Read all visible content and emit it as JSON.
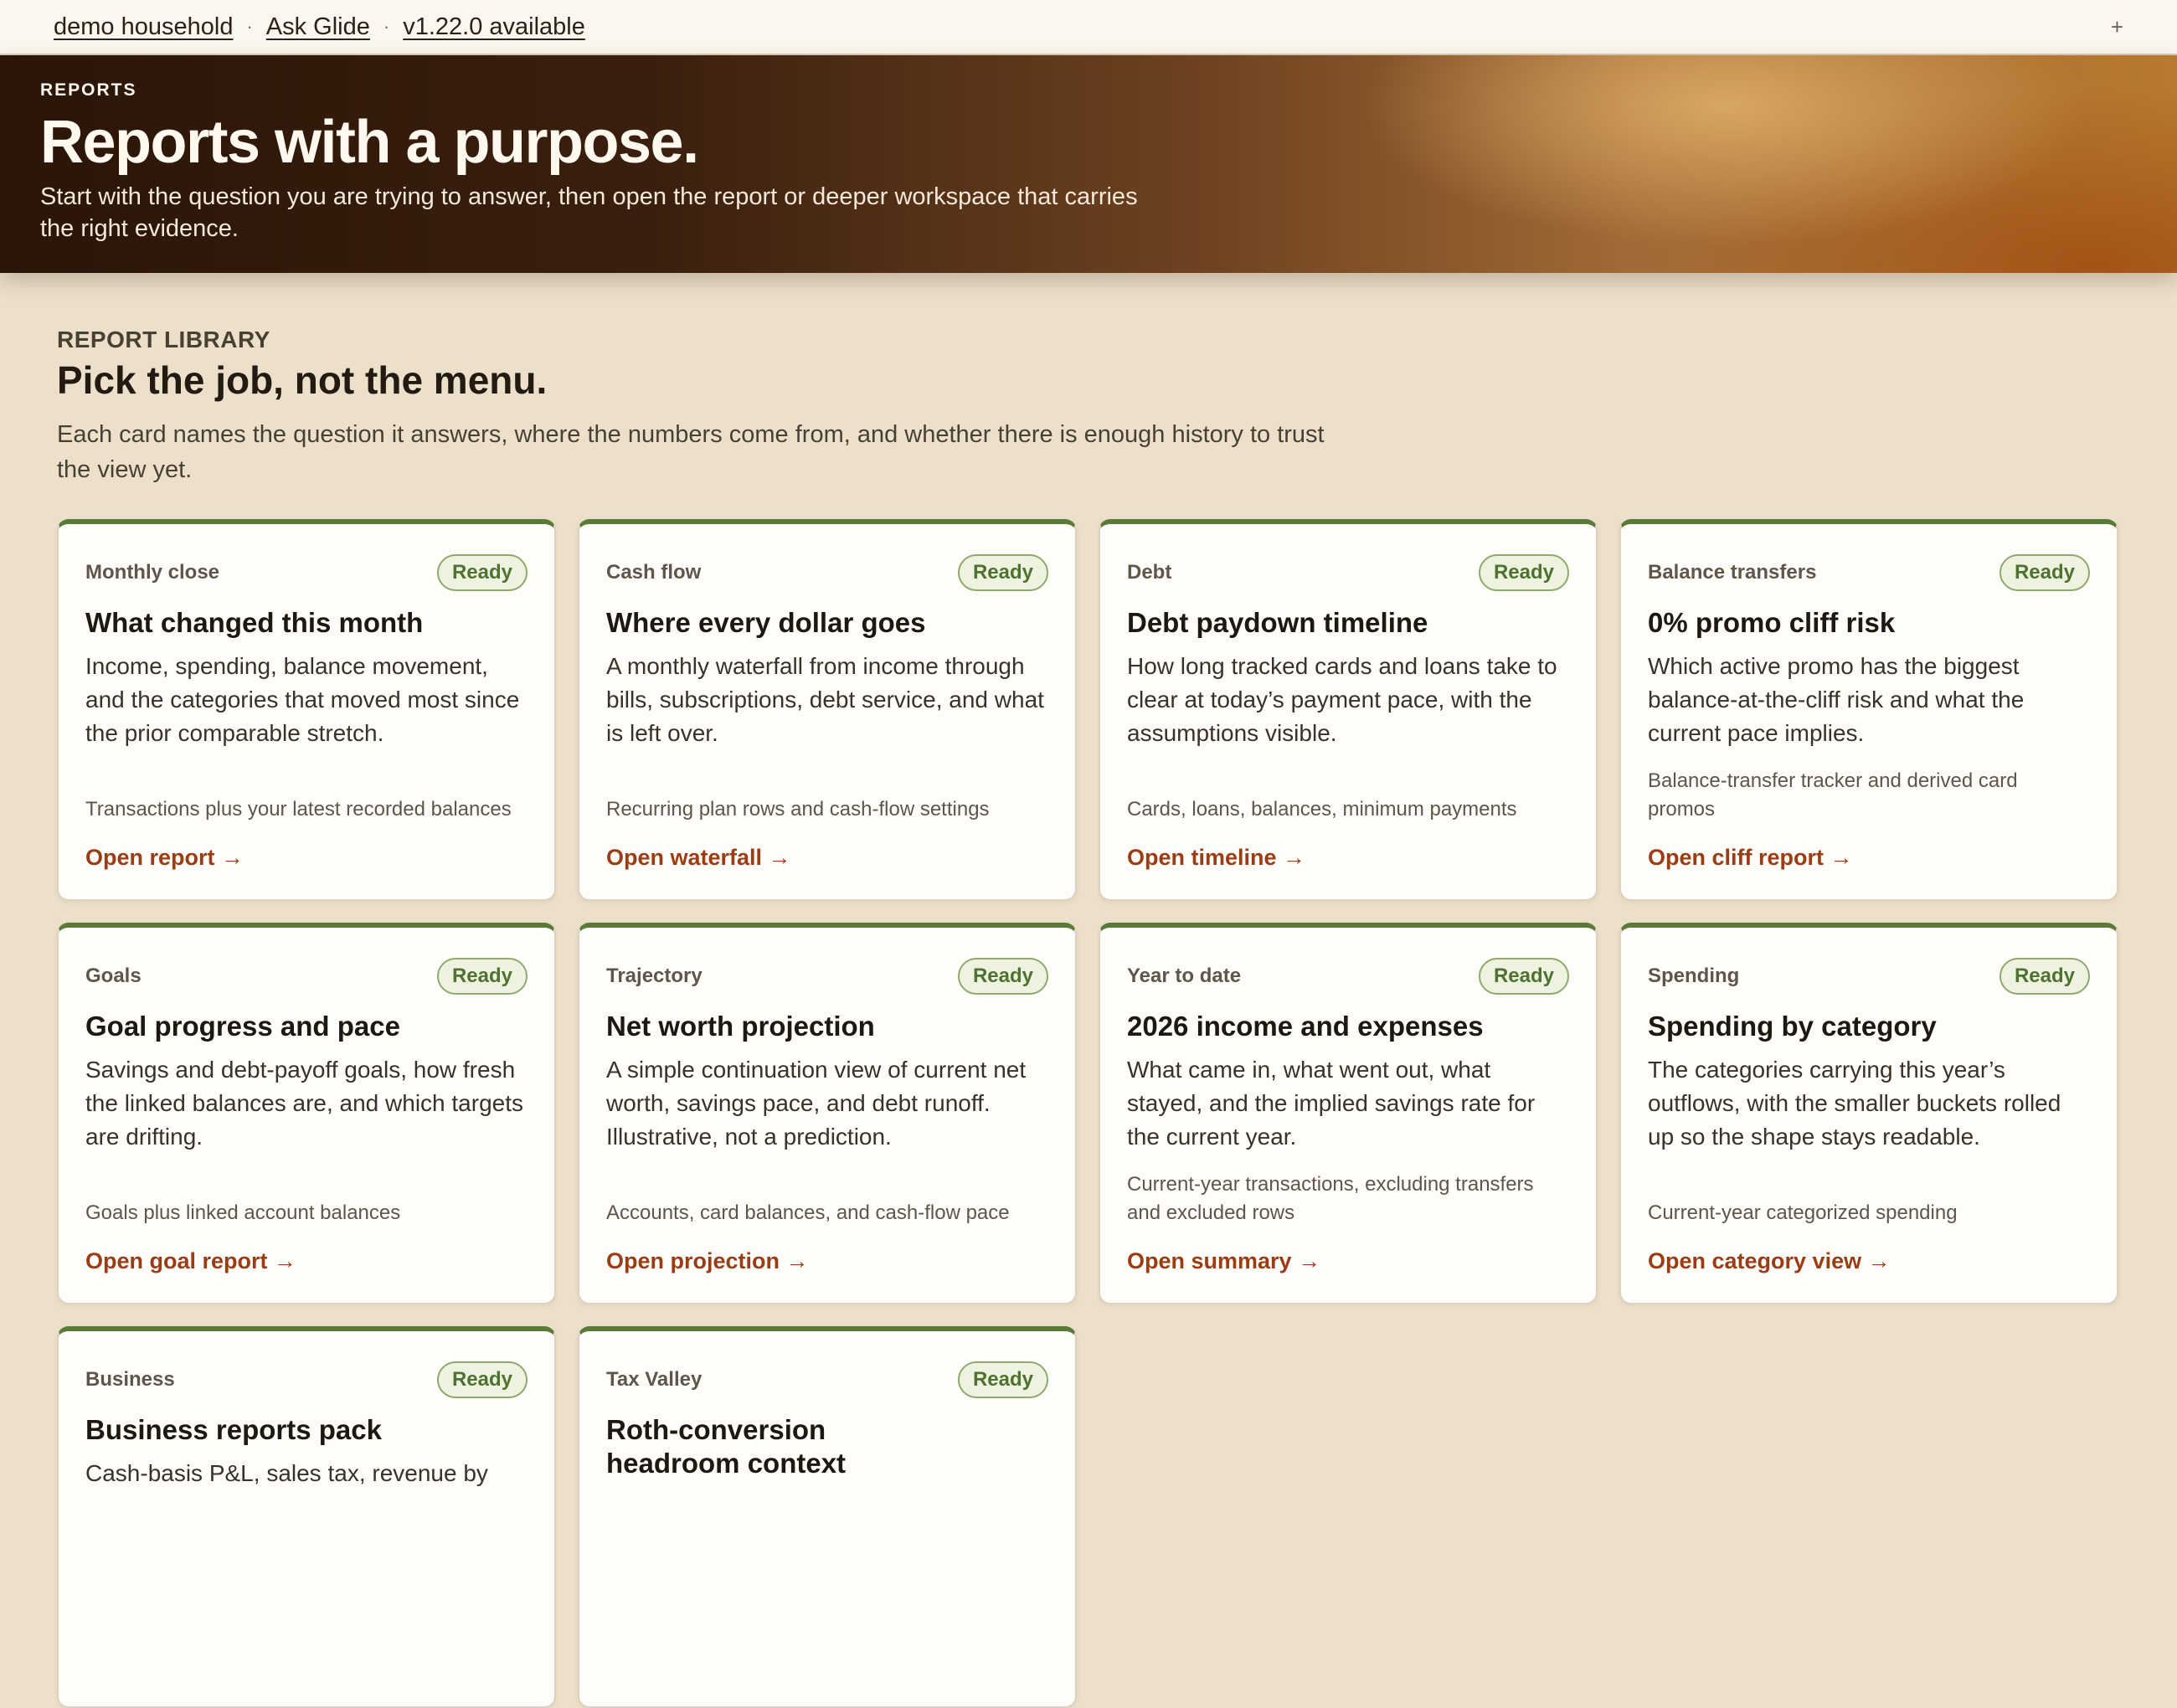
{
  "topbar": {
    "household": "demo household",
    "ask": "Ask Glide",
    "version": "v1.22.0 available",
    "separator": "·",
    "plus": "+"
  },
  "hero": {
    "eyebrow": "REPORTS",
    "title": "Reports with a purpose.",
    "subtitle": "Start with the question you are trying to answer, then open the report or deeper workspace that carries the right evidence."
  },
  "library": {
    "eyebrow": "REPORT LIBRARY",
    "title": "Pick the job, not the menu.",
    "lede": "Each card names the question it answers, where the numbers come from, and whether there is enough history to trust the view yet."
  },
  "cards": [
    {
      "kicker": "Monthly close",
      "badge": "Ready",
      "title": "What changed this month",
      "desc": "Income, spending, balance movement, and the categories that moved most since the prior comparable stretch.",
      "source": "Transactions plus your latest recorded balances",
      "cta": "Open report →"
    },
    {
      "kicker": "Cash flow",
      "badge": "Ready",
      "title": "Where every dollar goes",
      "desc": "A monthly waterfall from income through bills, subscriptions, debt service, and what is left over.",
      "source": "Recurring plan rows and cash-flow settings",
      "cta": "Open waterfall →"
    },
    {
      "kicker": "Debt",
      "badge": "Ready",
      "title": "Debt paydown timeline",
      "desc": "How long tracked cards and loans take to clear at today’s payment pace, with the assumptions visible.",
      "source": "Cards, loans, balances, minimum payments",
      "cta": "Open timeline →"
    },
    {
      "kicker": "Balance transfers",
      "badge": "Ready",
      "title": "0% promo cliff risk",
      "desc": "Which active promo has the biggest balance-at-the-cliff risk and what the current pace implies.",
      "source": "Balance-transfer tracker and derived card promos",
      "cta": "Open cliff report →"
    },
    {
      "kicker": "Goals",
      "badge": "Ready",
      "title": "Goal progress and pace",
      "desc": "Savings and debt-payoff goals, how fresh the linked balances are, and which targets are drifting.",
      "source": "Goals plus linked account balances",
      "cta": "Open goal report →"
    },
    {
      "kicker": "Trajectory",
      "badge": "Ready",
      "title": "Net worth projection",
      "desc": "A simple continuation view of current net worth, savings pace, and debt runoff. Illustrative, not a prediction.",
      "source": "Accounts, card balances, and cash-flow pace",
      "cta": "Open projection →"
    },
    {
      "kicker": "Year to date",
      "badge": "Ready",
      "title": "2026 income and expenses",
      "desc": "What came in, what went out, what stayed, and the implied savings rate for the current year.",
      "source": "Current-year transactions, excluding transfers and excluded rows",
      "cta": "Open summary →"
    },
    {
      "kicker": "Spending",
      "badge": "Ready",
      "title": "Spending by category",
      "desc": "The categories carrying this year’s outflows, with the smaller buckets rolled up so the shape stays readable.",
      "source": "Current-year categorized spending",
      "cta": "Open category view →"
    },
    {
      "kicker": "Business",
      "badge": "Ready",
      "title": "Business reports pack",
      "desc": "Cash-basis P&L, sales tax, revenue by",
      "source": "",
      "cta": ""
    },
    {
      "kicker": "Tax Valley",
      "badge": "Ready",
      "title": "Roth-conversion headroom context",
      "desc": "",
      "source": "",
      "cta": ""
    }
  ]
}
